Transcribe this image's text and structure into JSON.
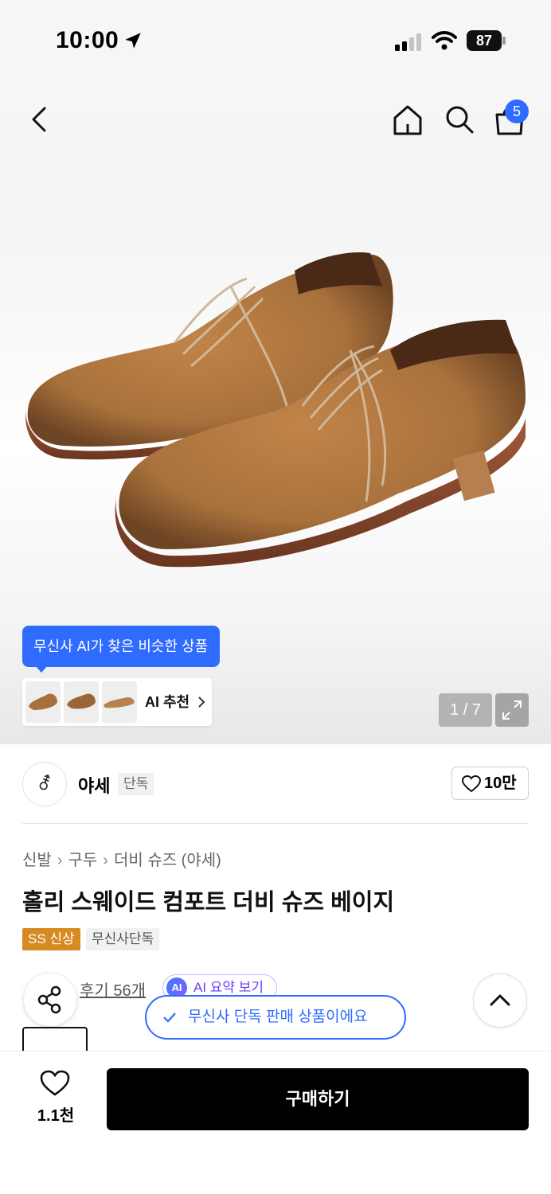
{
  "status_bar": {
    "time": "10:00",
    "battery": "87"
  },
  "header": {
    "cart_count": "5"
  },
  "gallery": {
    "ai_tooltip": "무신사 AI가 찾은 비슷한 상품",
    "ai_recommend_label": "AI 추천",
    "image_counter": "1 / 7"
  },
  "brand": {
    "logo_text": "⚦",
    "name": "야세",
    "tag": "단독",
    "likes": "10만"
  },
  "breadcrumb": [
    "신발",
    "구두",
    "더비 슈즈 (야세)"
  ],
  "product": {
    "title": "홀리 스웨이드 컴포트 더비 슈즈 베이지",
    "tags": [
      "SS 신상",
      "무신사단독"
    ],
    "review_text": "후기 56개",
    "ai_summary_icon": "AI",
    "ai_summary_label": "AI 요약 보기"
  },
  "toast": {
    "text": "무신사 단독 판매 상품이에요"
  },
  "bottom_bar": {
    "like_count": "1.1천",
    "buy_label": "구매하기"
  },
  "colors": {
    "accent": "#2f6bff",
    "new_tag": "#d68a21",
    "buy_button": "#000000",
    "ai_purple": "#6d3cff"
  },
  "icons": [
    "location-arrow-icon",
    "signal-icon",
    "wifi-icon",
    "battery-icon",
    "back-icon",
    "home-icon",
    "search-icon",
    "cart-icon",
    "chevron-right-icon",
    "expand-icon",
    "heart-icon",
    "share-icon",
    "chevron-up-icon",
    "check-icon"
  ]
}
